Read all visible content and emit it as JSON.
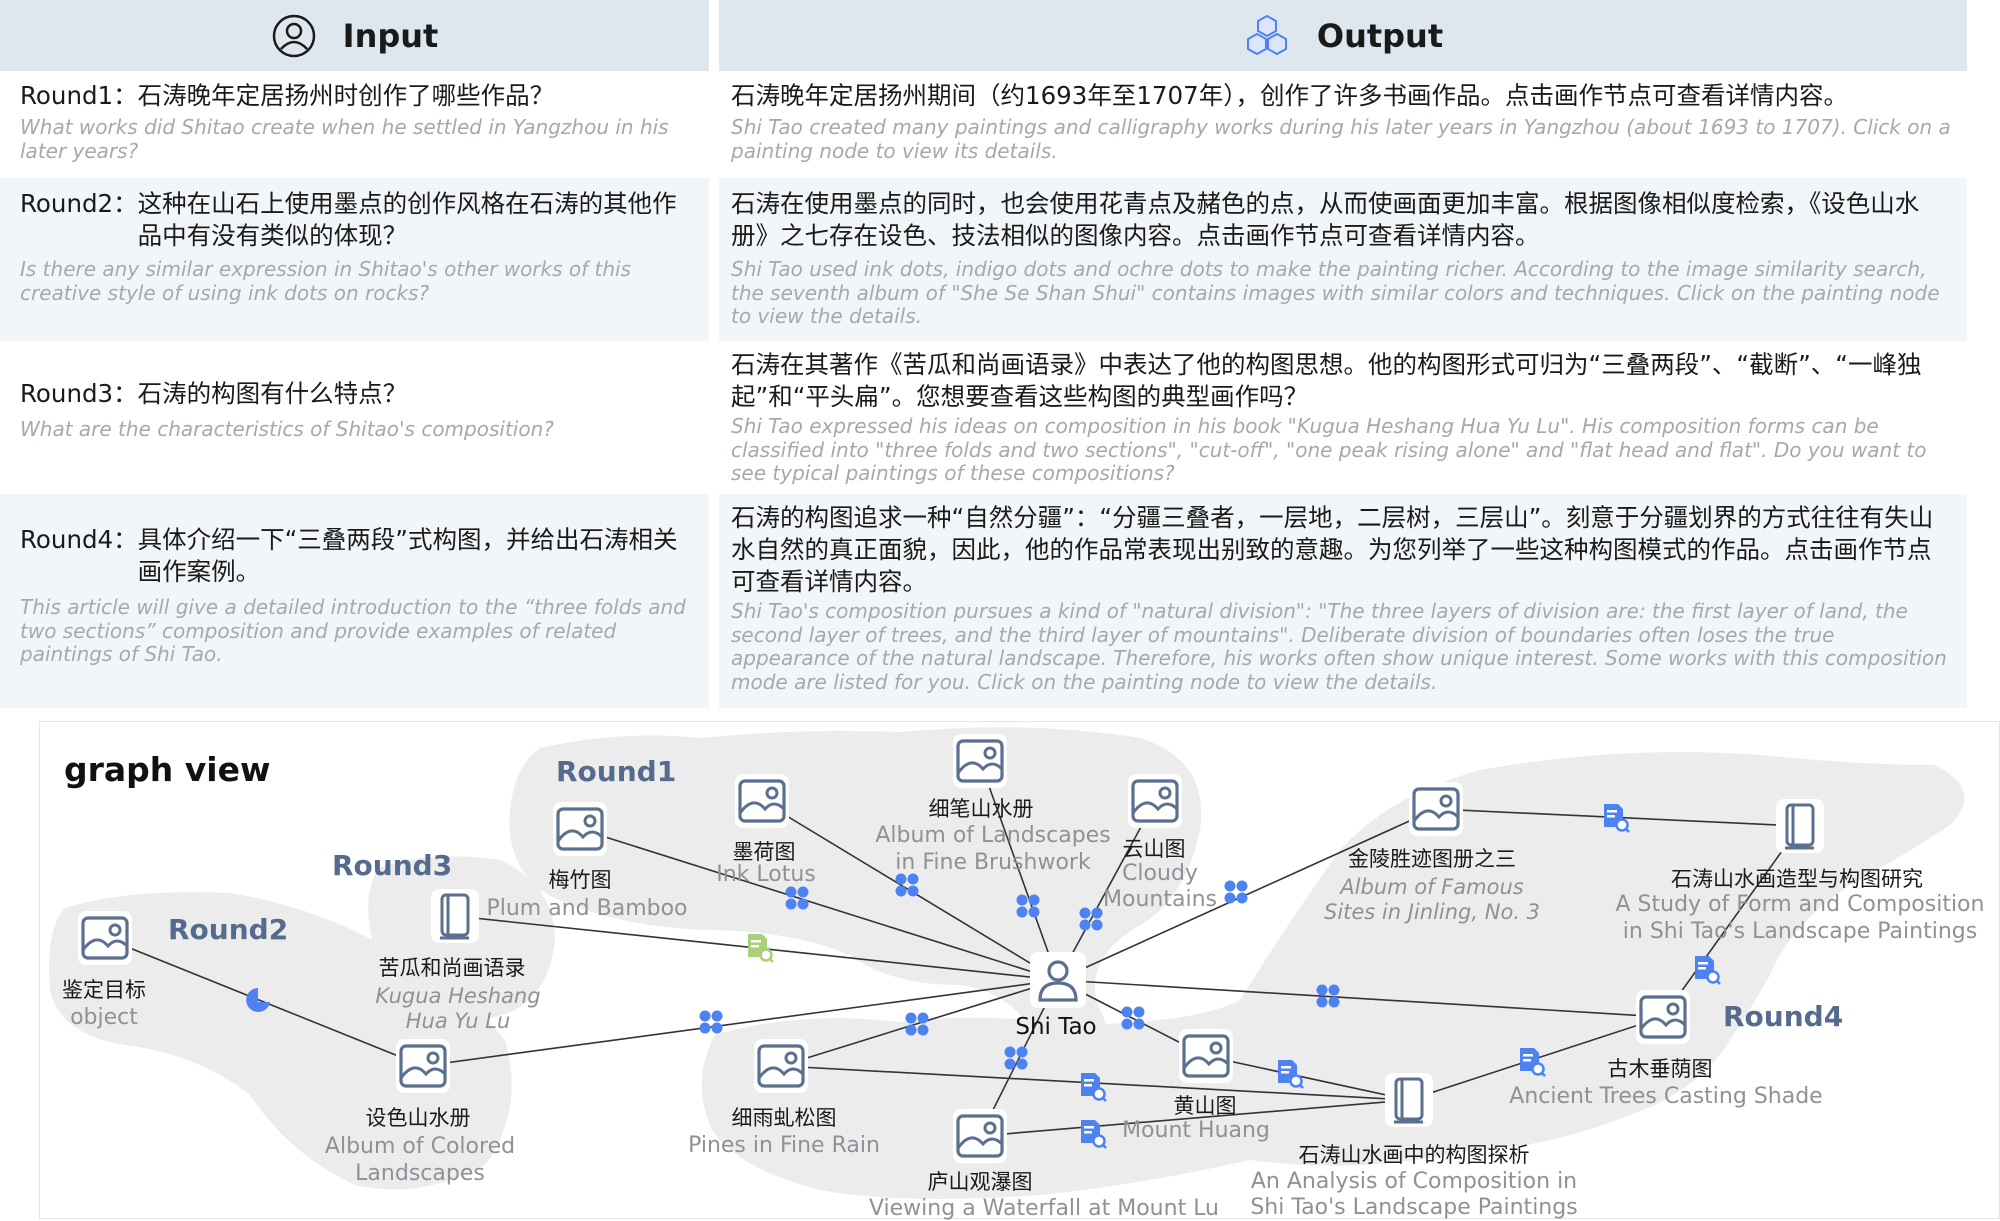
{
  "header": {
    "input_label": "Input",
    "output_label": "Output"
  },
  "rows": [
    {
      "q_label": "Round1：",
      "q_zh": "石涛晚年定居扬州时创作了哪些作品？",
      "q_en": "What works did Shitao create when he settled in Yangzhou in his later years?",
      "a_zh": "石涛晚年定居扬州期间（约1693年至1707年），创作了许多书画作品。点击画作节点可查看详情内容。",
      "a_en": "Shi Tao created many paintings and calligraphy works during his later years in Yangzhou (about 1693 to 1707). Click on a painting node to view its details."
    },
    {
      "q_label": "Round2：",
      "q_zh": "这种在山石上使用墨点的创作风格在石涛的其他作品中有没有类似的体现？",
      "q_en": "Is there any similar expression in Shitao's other works of this creative style of using ink dots on rocks?",
      "a_zh": "石涛在使用墨点的同时，也会使用花青点及赭色的点，从而使画面更加丰富。根据图像相似度检索，《设色山水册》之七存在设色、技法相似的图像内容。点击画作节点可查看详情内容。",
      "a_en": "Shi Tao used ink dots, indigo dots and ochre dots to make the painting richer. According to the image similarity search, the seventh album of \"She Se Shan Shui\" contains images with similar colors and techniques. Click on the painting node to view the details."
    },
    {
      "q_label": "Round3：",
      "q_zh": "石涛的构图有什么特点？",
      "q_en": "What are the characteristics of Shitao's composition?",
      "a_zh": "石涛在其著作《苦瓜和尚画语录》中表达了他的构图思想。他的构图形式可归为“三叠两段”、“截断”、“一峰独起”和“平头扁”。您想要查看这些构图的典型画作吗？",
      "a_en": "Shi Tao expressed his ideas on composition in his book \"Kugua Heshang Hua Yu Lu\". His composition forms can be classified into \"three folds and two sections\", \"cut-off\", \"one peak rising alone\" and \"flat head and flat\". Do you want to see typical paintings of these compositions?"
    },
    {
      "q_label": "Round4：",
      "q_zh": "具体介绍一下“三叠两段”式构图，并给出石涛相关画作案例。",
      "q_en": "This article will give a detailed introduction to the “three folds and two sections” composition and provide examples of related paintings of Shi Tao.",
      "a_zh": "石涛的构图追求一种“自然分疆”：“分疆三叠者，一层地，二层树，三层山”。刻意于分疆划界的方式往往有失山水自然的真正面貌，因此，他的作品常表现出别致的意趣。为您列举了一些这种构图模式的作品。点击画作节点可查看详情内容。",
      "a_en": "Shi Tao's composition pursues a kind of \"natural division\": \"The three layers of division are: the first layer of land, the second layer of trees, and the third layer of mountains\". Deliberate division of boundaries often loses the true appearance of the natural landscape. Therefore, his works often show unique interest. Some works with this composition mode are listed for you. Click on the painting node to view the details."
    }
  ],
  "graph": {
    "title": "graph view",
    "round_labels": [
      "Round1",
      "Round2",
      "Round3",
      "Round4"
    ],
    "center": {
      "label": "Shi Tao",
      "icon": "person-icon"
    },
    "nodes": {
      "meizhu": {
        "zh": "梅竹图",
        "en": "Plum and Bamboo",
        "icon": "painting-icon"
      },
      "mohe": {
        "zh": "墨荷图",
        "en": "Ink Lotus",
        "icon": "painting-icon"
      },
      "xibi": {
        "zh": "细笔山水册",
        "en1": "Album of Landscapes",
        "en2": "in Fine Brushwork",
        "icon": "painting-icon"
      },
      "yunshan": {
        "zh": "云山图",
        "en1": "Cloudy",
        "en2": "Mountains",
        "icon": "painting-icon"
      },
      "jinling": {
        "zh": "金陵胜迹图册之三",
        "en1": "Album of Famous",
        "en2": "Sites in Jinling, No. 3",
        "icon": "painting-icon"
      },
      "study": {
        "zh": "石涛山水画造型与构图研究",
        "en1": "A Study of Form and Composition",
        "en2": "in Shi Tao's Landscape Paintings",
        "icon": "book-icon"
      },
      "jianding": {
        "zh": "鉴定目标",
        "en": "object",
        "icon": "painting-icon"
      },
      "kugua": {
        "zh": "苦瓜和尚画语录",
        "en1": "Kugua Heshang",
        "en2": "Hua Yu Lu",
        "icon": "book-icon"
      },
      "sese": {
        "zh": "设色山水册",
        "en1": "Album of Colored",
        "en2": "Landscapes",
        "icon": "painting-icon"
      },
      "xiyu": {
        "zh": "细雨虬松图",
        "en": "Pines in Fine Rain",
        "icon": "painting-icon"
      },
      "lushan": {
        "zh": "庐山观瀑图",
        "en": "Viewing a Waterfall at Mount Lu",
        "icon": "painting-icon"
      },
      "huangshan": {
        "zh": "黄山图",
        "en": "Mount Huang",
        "icon": "painting-icon"
      },
      "analysis": {
        "zh": "石涛山水画中的构图探析",
        "en1": "An Analysis of Composition in",
        "en2": "Shi Tao's Landscape Paintings",
        "icon": "book-icon"
      },
      "gumu": {
        "zh": "古木垂荫图",
        "en": "Ancient Trees Casting Shade",
        "icon": "painting-icon"
      }
    }
  },
  "colors": {
    "header_bg": "#dfe7ee",
    "row_alt_bg": "#f2f6f9",
    "region_fill": "#ececed",
    "node_icon": "#5b6f8e",
    "relation_icon": "#4d82f0",
    "document_relation_icon": "#a8cf7a",
    "round_label": "#556b8d"
  }
}
